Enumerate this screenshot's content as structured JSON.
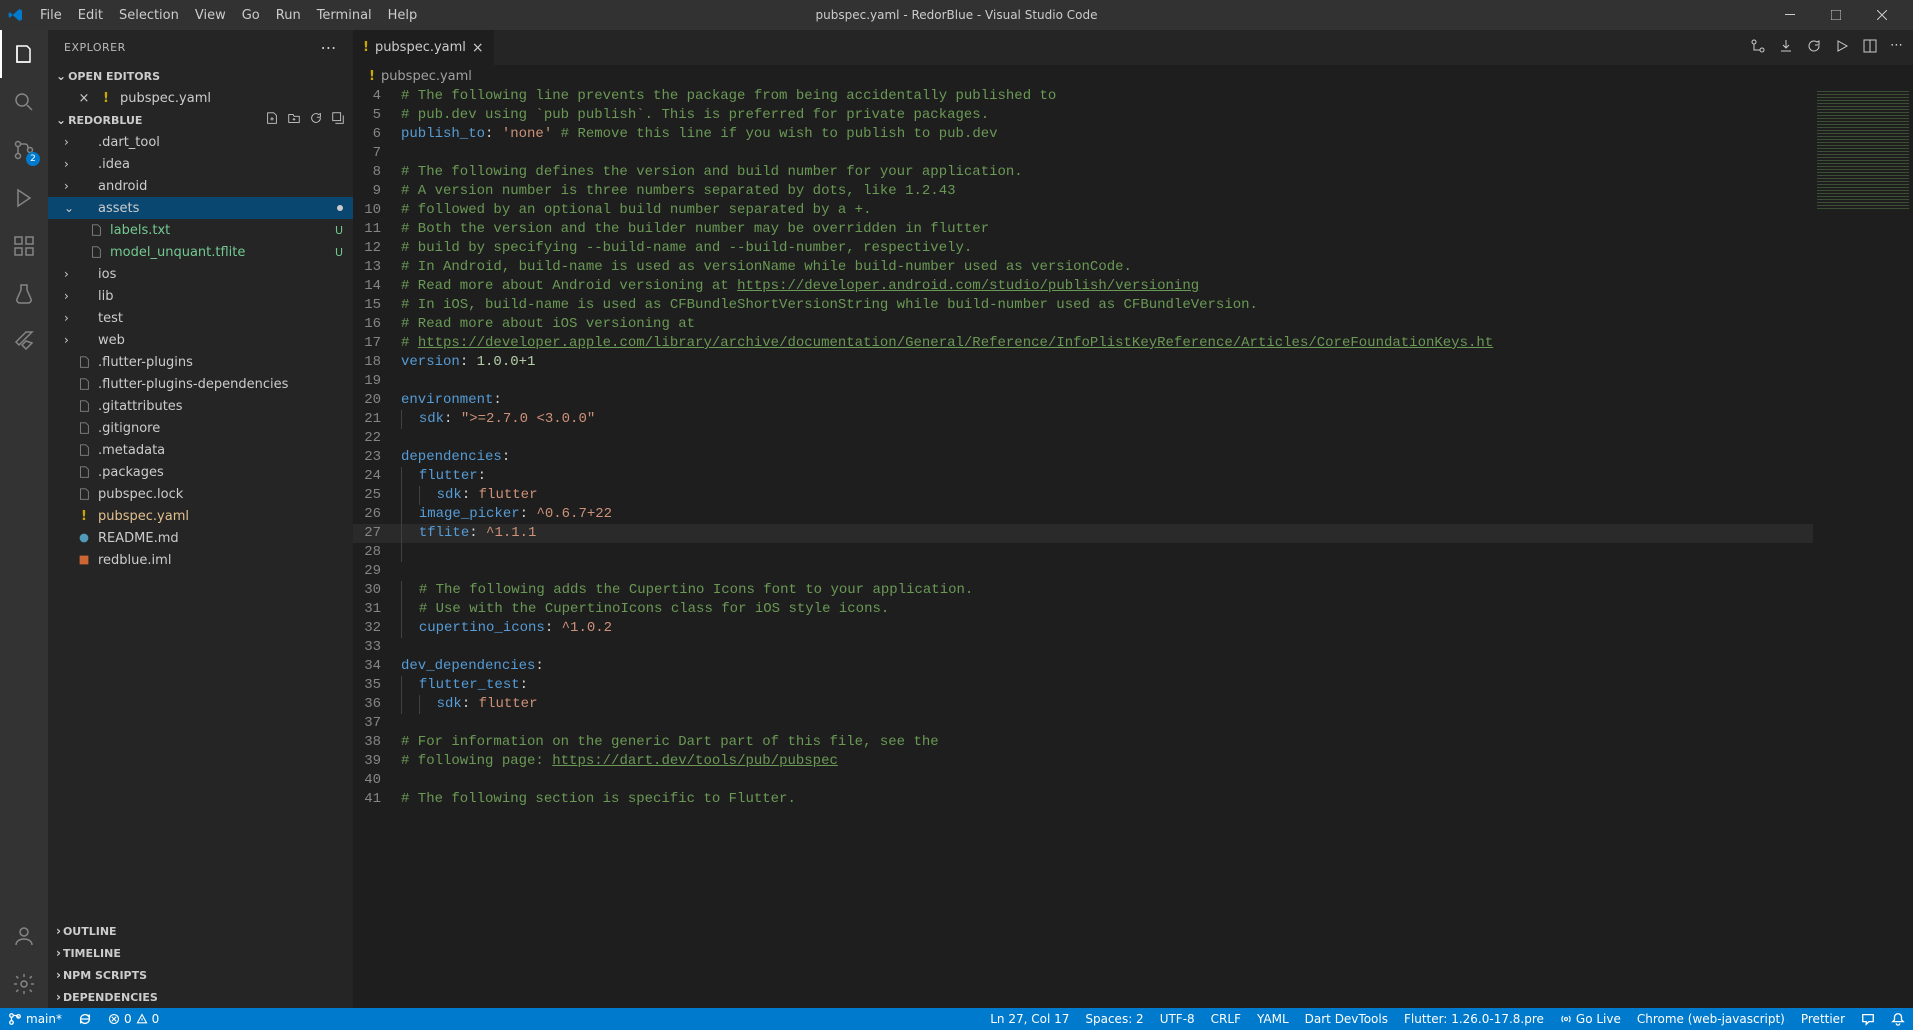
{
  "window": {
    "title": "pubspec.yaml - RedorBlue - Visual Studio Code"
  },
  "menubar": [
    "File",
    "Edit",
    "Selection",
    "View",
    "Go",
    "Run",
    "Terminal",
    "Help"
  ],
  "activity": {
    "scm_badge": "2"
  },
  "sidebar": {
    "title": "EXPLORER",
    "sections": {
      "open_editors": "OPEN EDITORS",
      "project": "REDORBLUE",
      "outline": "OUTLINE",
      "timeline": "TIMELINE",
      "npm_scripts": "NPM SCRIPTS",
      "dependencies": "DEPENDENCIES"
    },
    "open_editor_file": "pubspec.yaml",
    "tree": [
      {
        "name": ".dart_tool",
        "type": "folder"
      },
      {
        "name": ".idea",
        "type": "folder"
      },
      {
        "name": "android",
        "type": "folder"
      },
      {
        "name": "assets",
        "type": "folder",
        "selected": true,
        "expanded": true
      },
      {
        "name": "labels.txt",
        "type": "file",
        "indent": 1,
        "status": "U",
        "untracked": true
      },
      {
        "name": "model_unquant.tflite",
        "type": "file",
        "indent": 1,
        "status": "U",
        "untracked": true
      },
      {
        "name": "ios",
        "type": "folder"
      },
      {
        "name": "lib",
        "type": "folder"
      },
      {
        "name": "test",
        "type": "folder"
      },
      {
        "name": "web",
        "type": "folder"
      },
      {
        "name": ".flutter-plugins",
        "type": "file"
      },
      {
        "name": ".flutter-plugins-dependencies",
        "type": "file"
      },
      {
        "name": ".gitattributes",
        "type": "file"
      },
      {
        "name": ".gitignore",
        "type": "file"
      },
      {
        "name": ".metadata",
        "type": "file"
      },
      {
        "name": ".packages",
        "type": "file"
      },
      {
        "name": "pubspec.lock",
        "type": "file"
      },
      {
        "name": "pubspec.yaml",
        "type": "file",
        "modified": true
      },
      {
        "name": "README.md",
        "type": "file"
      },
      {
        "name": "redblue.iml",
        "type": "file"
      }
    ]
  },
  "tab": {
    "filename": "pubspec.yaml"
  },
  "breadcrumb": {
    "filename": "pubspec.yaml"
  },
  "editor": {
    "lines": [
      {
        "n": 4,
        "tokens": [
          {
            "t": "comment",
            "v": "# The following line prevents the package from being accidentally published to"
          }
        ]
      },
      {
        "n": 5,
        "tokens": [
          {
            "t": "comment",
            "v": "# pub.dev using `pub publish`. This is preferred for private packages."
          }
        ]
      },
      {
        "n": 6,
        "tokens": [
          {
            "t": "key",
            "v": "publish_to"
          },
          {
            "t": "punct",
            "v": ": "
          },
          {
            "t": "string",
            "v": "'none'"
          },
          {
            "t": "comment",
            "v": " # Remove this line if you wish to publish to pub.dev"
          }
        ]
      },
      {
        "n": 7,
        "tokens": []
      },
      {
        "n": 8,
        "tokens": [
          {
            "t": "comment",
            "v": "# The following defines the version and build number for your application."
          }
        ]
      },
      {
        "n": 9,
        "tokens": [
          {
            "t": "comment",
            "v": "# A version number is three numbers separated by dots, like 1.2.43"
          }
        ]
      },
      {
        "n": 10,
        "tokens": [
          {
            "t": "comment",
            "v": "# followed by an optional build number separated by a +."
          }
        ]
      },
      {
        "n": 11,
        "tokens": [
          {
            "t": "comment",
            "v": "# Both the version and the builder number may be overridden in flutter"
          }
        ]
      },
      {
        "n": 12,
        "tokens": [
          {
            "t": "comment",
            "v": "# build by specifying --build-name and --build-number, respectively."
          }
        ]
      },
      {
        "n": 13,
        "tokens": [
          {
            "t": "comment",
            "v": "# In Android, build-name is used as versionName while build-number used as versionCode."
          }
        ]
      },
      {
        "n": 14,
        "tokens": [
          {
            "t": "comment",
            "v": "# Read more about Android versioning at "
          },
          {
            "t": "link",
            "v": "https://developer.android.com/studio/publish/versioning"
          }
        ]
      },
      {
        "n": 15,
        "tokens": [
          {
            "t": "comment",
            "v": "# In iOS, build-name is used as CFBundleShortVersionString while build-number used as CFBundleVersion."
          }
        ]
      },
      {
        "n": 16,
        "tokens": [
          {
            "t": "comment",
            "v": "# Read more about iOS versioning at"
          }
        ]
      },
      {
        "n": 17,
        "tokens": [
          {
            "t": "comment",
            "v": "# "
          },
          {
            "t": "link",
            "v": "https://developer.apple.com/library/archive/documentation/General/Reference/InfoPlistKeyReference/Articles/CoreFoundationKeys.ht"
          }
        ]
      },
      {
        "n": 18,
        "tokens": [
          {
            "t": "key",
            "v": "version"
          },
          {
            "t": "punct",
            "v": ": "
          },
          {
            "t": "number",
            "v": "1.0.0+1"
          }
        ]
      },
      {
        "n": 19,
        "tokens": []
      },
      {
        "n": 20,
        "tokens": [
          {
            "t": "key",
            "v": "environment"
          },
          {
            "t": "punct",
            "v": ":"
          }
        ]
      },
      {
        "n": 21,
        "indent": 1,
        "tokens": [
          {
            "t": "key",
            "v": "sdk"
          },
          {
            "t": "punct",
            "v": ": "
          },
          {
            "t": "string",
            "v": "\">=2.7.0 <3.0.0\""
          }
        ]
      },
      {
        "n": 22,
        "tokens": []
      },
      {
        "n": 23,
        "tokens": [
          {
            "t": "key",
            "v": "dependencies"
          },
          {
            "t": "punct",
            "v": ":"
          }
        ]
      },
      {
        "n": 24,
        "indent": 1,
        "tokens": [
          {
            "t": "key",
            "v": "flutter"
          },
          {
            "t": "punct",
            "v": ":"
          }
        ]
      },
      {
        "n": 25,
        "indent": 2,
        "tokens": [
          {
            "t": "key",
            "v": "sdk"
          },
          {
            "t": "punct",
            "v": ": "
          },
          {
            "t": "string",
            "v": "flutter"
          }
        ]
      },
      {
        "n": 26,
        "indent": 1,
        "tokens": [
          {
            "t": "key",
            "v": "image_picker"
          },
          {
            "t": "punct",
            "v": ": "
          },
          {
            "t": "string",
            "v": "^0.6.7+22"
          }
        ]
      },
      {
        "n": 27,
        "active": true,
        "indent": 1,
        "tokens": [
          {
            "t": "key",
            "v": "tflite"
          },
          {
            "t": "punct",
            "v": ": "
          },
          {
            "t": "string",
            "v": "^1.1.1"
          }
        ]
      },
      {
        "n": 28,
        "indent": 1,
        "tokens": []
      },
      {
        "n": 29,
        "tokens": []
      },
      {
        "n": 30,
        "indent": 1,
        "tokens": [
          {
            "t": "comment",
            "v": "# The following adds the Cupertino Icons font to your application."
          }
        ]
      },
      {
        "n": 31,
        "indent": 1,
        "tokens": [
          {
            "t": "comment",
            "v": "# Use with the CupertinoIcons class for iOS style icons."
          }
        ]
      },
      {
        "n": 32,
        "indent": 1,
        "tokens": [
          {
            "t": "key",
            "v": "cupertino_icons"
          },
          {
            "t": "punct",
            "v": ": "
          },
          {
            "t": "string",
            "v": "^1.0.2"
          }
        ]
      },
      {
        "n": 33,
        "tokens": []
      },
      {
        "n": 34,
        "tokens": [
          {
            "t": "key",
            "v": "dev_dependencies"
          },
          {
            "t": "punct",
            "v": ":"
          }
        ]
      },
      {
        "n": 35,
        "indent": 1,
        "tokens": [
          {
            "t": "key",
            "v": "flutter_test"
          },
          {
            "t": "punct",
            "v": ":"
          }
        ]
      },
      {
        "n": 36,
        "indent": 2,
        "tokens": [
          {
            "t": "key",
            "v": "sdk"
          },
          {
            "t": "punct",
            "v": ": "
          },
          {
            "t": "string",
            "v": "flutter"
          }
        ]
      },
      {
        "n": 37,
        "tokens": []
      },
      {
        "n": 38,
        "tokens": [
          {
            "t": "comment",
            "v": "# For information on the generic Dart part of this file, see the"
          }
        ]
      },
      {
        "n": 39,
        "tokens": [
          {
            "t": "comment",
            "v": "# following page: "
          },
          {
            "t": "link",
            "v": "https://dart.dev/tools/pub/pubspec"
          }
        ]
      },
      {
        "n": 40,
        "tokens": []
      },
      {
        "n": 41,
        "tokens": [
          {
            "t": "comment",
            "v": "# The following section is specific to Flutter."
          }
        ]
      }
    ]
  },
  "statusbar": {
    "branch": "main*",
    "sync": "",
    "errors": "0",
    "warnings": "0",
    "cursor": "Ln 27, Col 17",
    "spaces": "Spaces: 2",
    "encoding": "UTF-8",
    "eol": "CRLF",
    "language": "YAML",
    "devtools": "Dart DevTools",
    "flutter": "Flutter: 1.26.0-17.8.pre",
    "golive": "Go Live",
    "chrome": "Chrome (web-javascript)",
    "prettier": "Prettier"
  }
}
